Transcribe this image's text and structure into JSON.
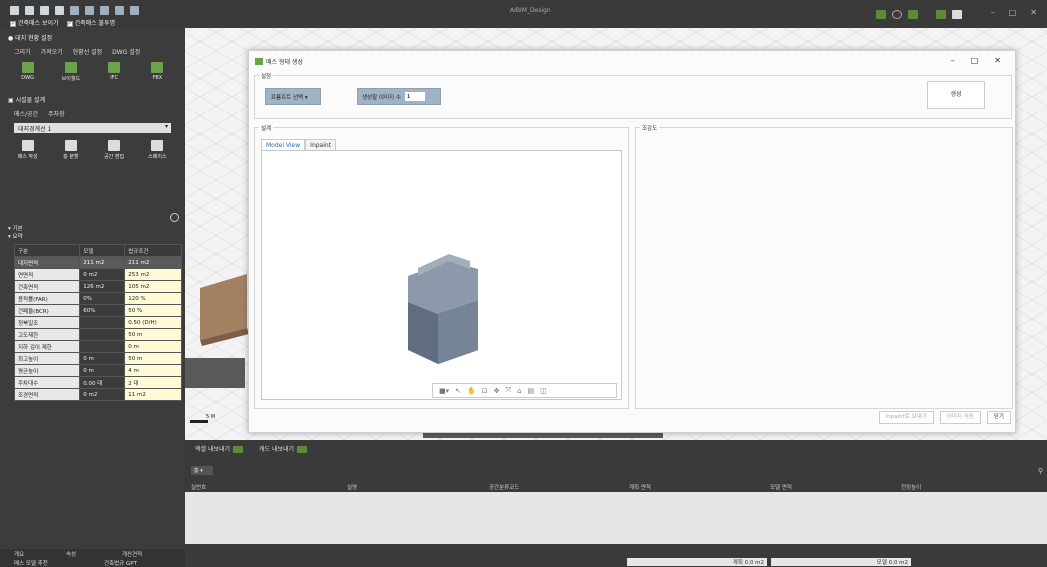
{
  "app": {
    "title": "AIBIM_Design",
    "checkbox_mass_show": "건축매스 보이기",
    "checkbox_mass_opaque": "건축매스 불투명"
  },
  "left": {
    "site_header": "대지 현황 설정",
    "site_tabs": [
      "그리기",
      "가져오기",
      "현황선 설정",
      "DWG 설정"
    ],
    "site_tools": [
      "DWG",
      "브이월드",
      "IFC",
      "FBX"
    ],
    "facility_header": "시설물 설계",
    "facility_tabs": [
      "매스/공간",
      "주차장"
    ],
    "site_combo_value": "대지경계선 1",
    "facility_tools": [
      "매스 작성",
      "층 분할",
      "공간 편집",
      "스페이스"
    ],
    "basic_label": "기본",
    "summary_label": "요약",
    "table": {
      "headers": [
        "구분",
        "모델",
        "법규조건"
      ],
      "rows": [
        [
          "대지면적",
          "211 m2",
          "211 m2"
        ],
        [
          "연면적",
          "0 m2",
          "253 m2"
        ],
        [
          "건축면적",
          "126 m2",
          "105 m2"
        ],
        [
          "용적률(FAR)",
          "0%",
          "120 %"
        ],
        [
          "건폐율(BCR)",
          "60%",
          "50 %"
        ],
        [
          "정북일조",
          "",
          "0.50 (D/H)"
        ],
        [
          "고도제한",
          "",
          "50 m"
        ],
        [
          "지하 깊이 제한",
          "",
          "0 m"
        ],
        [
          "최고높이",
          "0 m",
          "50 m"
        ],
        [
          "평균높이",
          "0 m",
          "4 m"
        ],
        [
          "주차대수",
          "0.00 대",
          "2 대"
        ],
        [
          "조경면적",
          "0 m2",
          "11 m2"
        ]
      ]
    },
    "bottom_tabs": [
      "개요",
      "속성",
      "개산견적"
    ],
    "bottom_row2": [
      "매스 모델 추천",
      "건축법규 GPT"
    ]
  },
  "dialog": {
    "title": "매스 형태 생성",
    "settings_label": "설정",
    "prompt_select_label": "프롬프트 선택",
    "image_count_label": "생성할 이미지 수",
    "image_count_value": "1",
    "generate_label": "생성",
    "design_label": "설계",
    "tabs": [
      "Model View",
      "Inpaint"
    ],
    "birdseye_label": "조감도",
    "footer_buttons": [
      "Inpaint로 보내기",
      "이미지 저장",
      "닫기"
    ]
  },
  "bottom": {
    "tabs": [
      "엑셀 내보내기",
      "캐드 내보내기"
    ],
    "columns": [
      "실번호",
      "실명",
      "공간분류코드",
      "계획 면적",
      "모델 면적",
      "천정높이"
    ],
    "planned_area_status": "계획 0.0 m2",
    "model_area_status": "모델 0.0 m2"
  },
  "canvas": {
    "scale_label": "5 M"
  }
}
